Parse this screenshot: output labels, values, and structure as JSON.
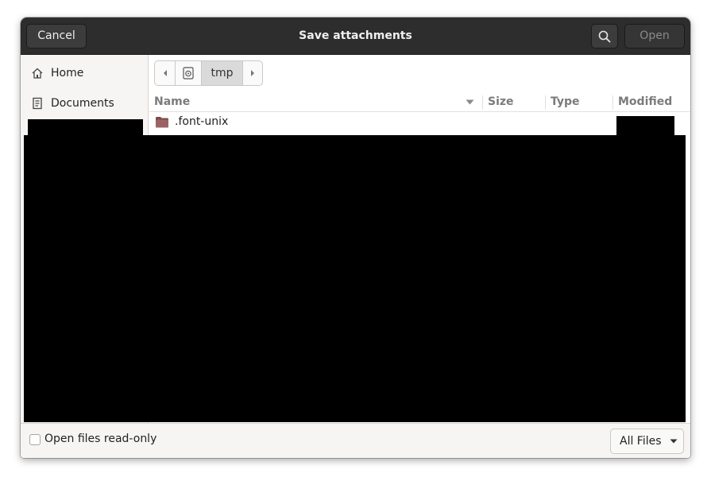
{
  "header": {
    "cancel_label": "Cancel",
    "title": "Save attachments",
    "open_label": "Open"
  },
  "sidebar": {
    "items": [
      {
        "label": "Home",
        "icon": "home-icon"
      },
      {
        "label": "Documents",
        "icon": "documents-icon"
      }
    ]
  },
  "pathbar": {
    "current": "tmp"
  },
  "columns": {
    "name": "Name",
    "size": "Size",
    "type": "Type",
    "modified": "Modified"
  },
  "files": [
    {
      "name": ".font-unix",
      "icon": "folder-icon"
    }
  ],
  "footer": {
    "readonly_label": "Open files read-only",
    "filter_label": "All Files"
  },
  "colors": {
    "header_bg": "#2d2d2d",
    "sidebar_bg": "#f6f5f4",
    "folder": "#8f5a5a"
  }
}
